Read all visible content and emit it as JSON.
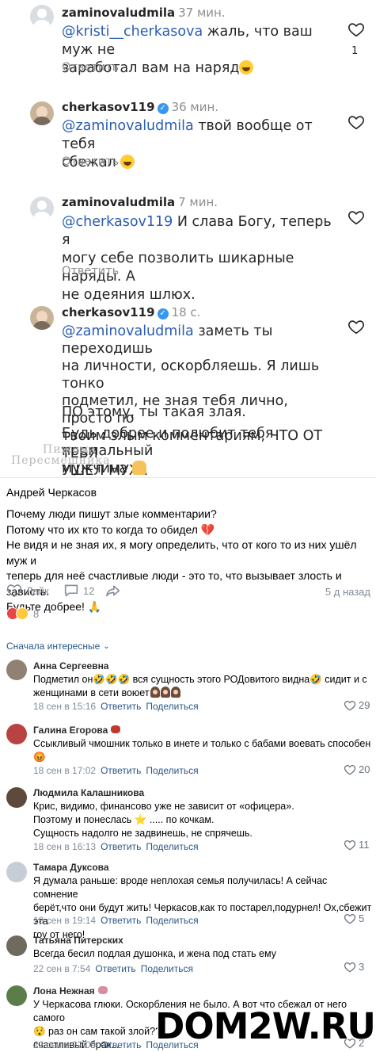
{
  "instagram": {
    "comments": [
      {
        "username": "zaminovaludmila",
        "time": "37 мин.",
        "verified": false,
        "mention": "@kristi__cherkasova",
        "text_after_mention": " жаль, что ваш муж не",
        "text_line2": "заработал вам на наряд",
        "emoji": "rofl",
        "reply": "Ответить",
        "likes": "1"
      },
      {
        "username": "cherkasov119",
        "time": "36 мин.",
        "verified": true,
        "mention": "@zaminovaludmila",
        "text_after_mention": " твой вообще от тебя",
        "text_line2": "сбежал",
        "emoji": "rofl",
        "reply": "Ответить",
        "likes": ""
      },
      {
        "username": "zaminovaludmila",
        "time": "7 мин.",
        "verified": false,
        "mention": "@cherkasov119",
        "text_after_mention": " И слава Богу, теперь я",
        "text_line2": "могу себе позволить шикарные наряды. А",
        "text_line3": "не одеяния шлюх.",
        "reply": "Ответить",
        "likes": ""
      },
      {
        "username": "cherkasov119",
        "time": "18 с.",
        "verified": true,
        "mention": "@zaminovaludmila",
        "text_after_mention": " заметь ты переходишь",
        "text_line2": "на личности, оскорбляешь. Я лишь тонко",
        "text_line3": "подметил, не зная тебя лично, просто по",
        "text_line4": "твоим злым комментариям, ЧТО ОТ ТЕБЯ",
        "text_line5": "УШЕЛ МУЖ.",
        "text_line6": "ПО этому, ты такая злая.",
        "text_line7": "Будь добрее и полюбит тебя нормальный",
        "text_line8": "мужчина",
        "likes": ""
      }
    ],
    "watermark_line1": "Пижама",
    "watermark_line2": "Пересмешника"
  },
  "vk": {
    "author": "Андрей Черкасов",
    "post_lines": [
      "Почему люди пишут злые комментарии?",
      "Потому что их кто то когда то обидел 💔",
      "Не видя и не зная их, я могу определить, что от кого то из них ушёл муж и",
      "теперь для неё счастливые люди - это то, что вызывает злость и зависть.",
      "Будьте добрее! 🙏"
    ],
    "like_label": "Лайк",
    "comments_count": "12",
    "date": "5 д назад",
    "reactions_count": "8",
    "sort_label": "Сначала интересные",
    "comments": [
      {
        "name": "Анна Сергеевна",
        "lines": [
          "Подметил он🤣🤣🤣 вся сущность этого РОДовитого видна🤣 сидит и с",
          "женщинами в сети воюет"
        ],
        "date": "18 сен в 15:16",
        "reply": "Ответить",
        "share": "Поделиться",
        "likes": "29"
      },
      {
        "name": "Галина Егорова",
        "lines": [
          "Ссыкливый чмошник только в инете и только с бабами воевать способен",
          "😡"
        ],
        "date": "18 сен в 17:02",
        "reply": "Ответить",
        "share": "Поделиться",
        "likes": "20"
      },
      {
        "name": "Людмила Калашникова",
        "lines": [
          "Крис, видимо, финансово уже не зависит от «офицера».",
          "Поэтому и понеслась ⭐ ..... по кочкам.",
          "Сущность надолго не задвинешь, не спрячешь."
        ],
        "date": "18 сен в 16:13",
        "reply": "Ответить",
        "share": "Поделиться",
        "likes": "11"
      },
      {
        "name": "Тамара Дуксова",
        "lines": [
          "Я думала раньше: вроде неплохая семья получилась! А сейчас сомнение",
          "берёт,что они будут жить! Черкасов,как то постарел,подурнел! Ох,сбежит эта",
          "гоу от него!"
        ],
        "date": "18 сен в 19:14",
        "reply": "Ответить",
        "share": "Поделиться",
        "likes": "5"
      },
      {
        "name": "Татьяна Питерских",
        "lines": [
          "Всегда бесил подлая душонка, и жена под стать ему"
        ],
        "date": "22 сен в 7:54",
        "reply": "Ответить",
        "share": "Поделиться",
        "likes": "3"
      },
      {
        "name": "Лона Нежная",
        "lines": [
          "У Черкасова глюки. Оскорбления не было. А вот что сбежал от него самого",
          "😯 раз он сам такой злой??? ...",
          "счастливый брак..."
        ],
        "date": "22 сен в 22:09",
        "reply": "Ответить",
        "share": "Поделиться",
        "likes": "2"
      }
    ]
  },
  "site_watermark": "DOM2W.RU",
  "colors": {
    "link": "#2a5885",
    "mention": "#2a5db0",
    "muted": "#818c99",
    "heart_red": "#c0392b"
  }
}
